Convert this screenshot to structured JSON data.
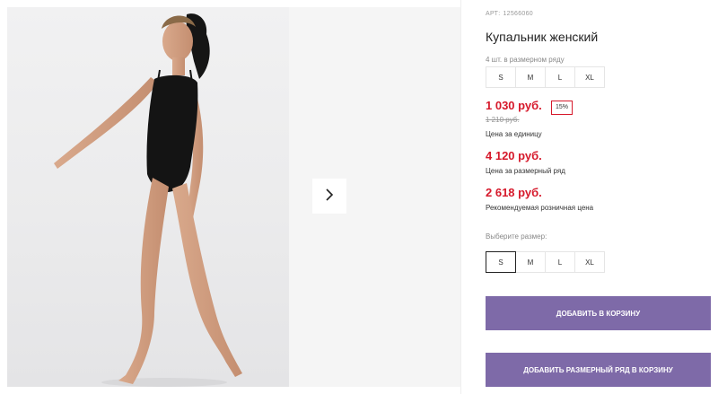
{
  "gallery": {
    "image_alt": "",
    "next_icon": "chevron-right-icon"
  },
  "product": {
    "sku_label": "АРТ:",
    "sku_value": "12566060",
    "title": "Купальник женский",
    "size_row_note": "4 шт. в размерном ряду",
    "size_row_sizes": [
      "S",
      "M",
      "L",
      "XL"
    ],
    "unit_price": "1 030 руб.",
    "discount": "15%",
    "old_price": "1 210 руб.",
    "unit_price_caption": "Цена за единицу",
    "row_price": "4 120 руб.",
    "row_price_caption": "Цена за размерный ряд",
    "retail_price": "2 618 руб.",
    "retail_price_caption": "Рекомендуемая розничная цена",
    "choose_size_label": "Выберите размер:",
    "size_options": [
      "S",
      "M",
      "L",
      "XL"
    ],
    "selected_size": "S",
    "add_to_cart": "Добавить в корзину",
    "add_row_to_cart": "Добавить размерный ряд в корзину"
  },
  "colors": {
    "price": "#d6192b",
    "button": "#7e6aa8"
  }
}
